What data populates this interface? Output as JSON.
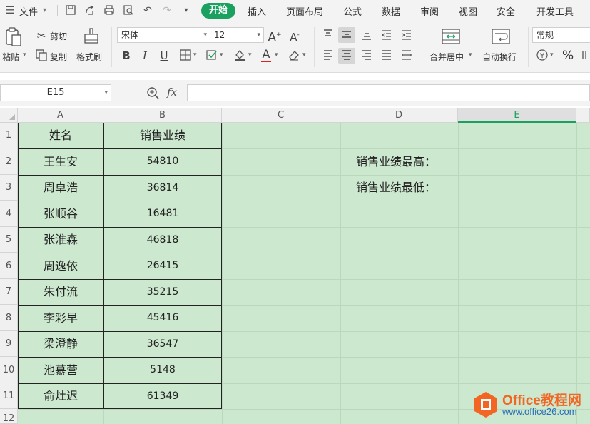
{
  "menubar": {
    "file_label": "文件",
    "tabs": [
      "开始",
      "插入",
      "页面布局",
      "公式",
      "数据",
      "审阅",
      "视图",
      "安全",
      "开发工具"
    ]
  },
  "ribbon": {
    "paste_label": "粘贴",
    "cut_label": "剪切",
    "copy_label": "复制",
    "format_painter_label": "格式刷",
    "font_name": "宋体",
    "font_size": "12",
    "merge_label": "合并居中",
    "wrap_label": "自动换行",
    "number_format": "常规",
    "percent": "%"
  },
  "formula_bar": {
    "cell_ref": "E15",
    "fx": "fx",
    "formula": ""
  },
  "columns": [
    "A",
    "B",
    "C",
    "D",
    "E"
  ],
  "rows": [
    "1",
    "2",
    "3",
    "4",
    "5",
    "6",
    "7",
    "8",
    "9",
    "10",
    "11",
    "12"
  ],
  "table": {
    "headers": [
      "姓名",
      "销售业绩"
    ],
    "rows": [
      [
        "王生安",
        "54810"
      ],
      [
        "周卓浩",
        "36814"
      ],
      [
        "张顺谷",
        "16481"
      ],
      [
        "张淮森",
        "46818"
      ],
      [
        "周逸依",
        "26415"
      ],
      [
        "朱付流",
        "35215"
      ],
      [
        "李彩早",
        "45416"
      ],
      [
        "梁澄静",
        "36547"
      ],
      [
        "池慕营",
        "5148"
      ],
      [
        "俞灶迟",
        "61349"
      ]
    ]
  },
  "notes": {
    "max_label": "销售业绩最高：",
    "min_label": "销售业绩最低："
  },
  "watermark": {
    "title": "Office教程网",
    "url": "www.office26.com"
  },
  "colors": {
    "accent": "#1aa15f",
    "sheet_bg": "#cce8cf",
    "watermark_orange": "#f26522",
    "watermark_blue": "#2a6fb5"
  }
}
